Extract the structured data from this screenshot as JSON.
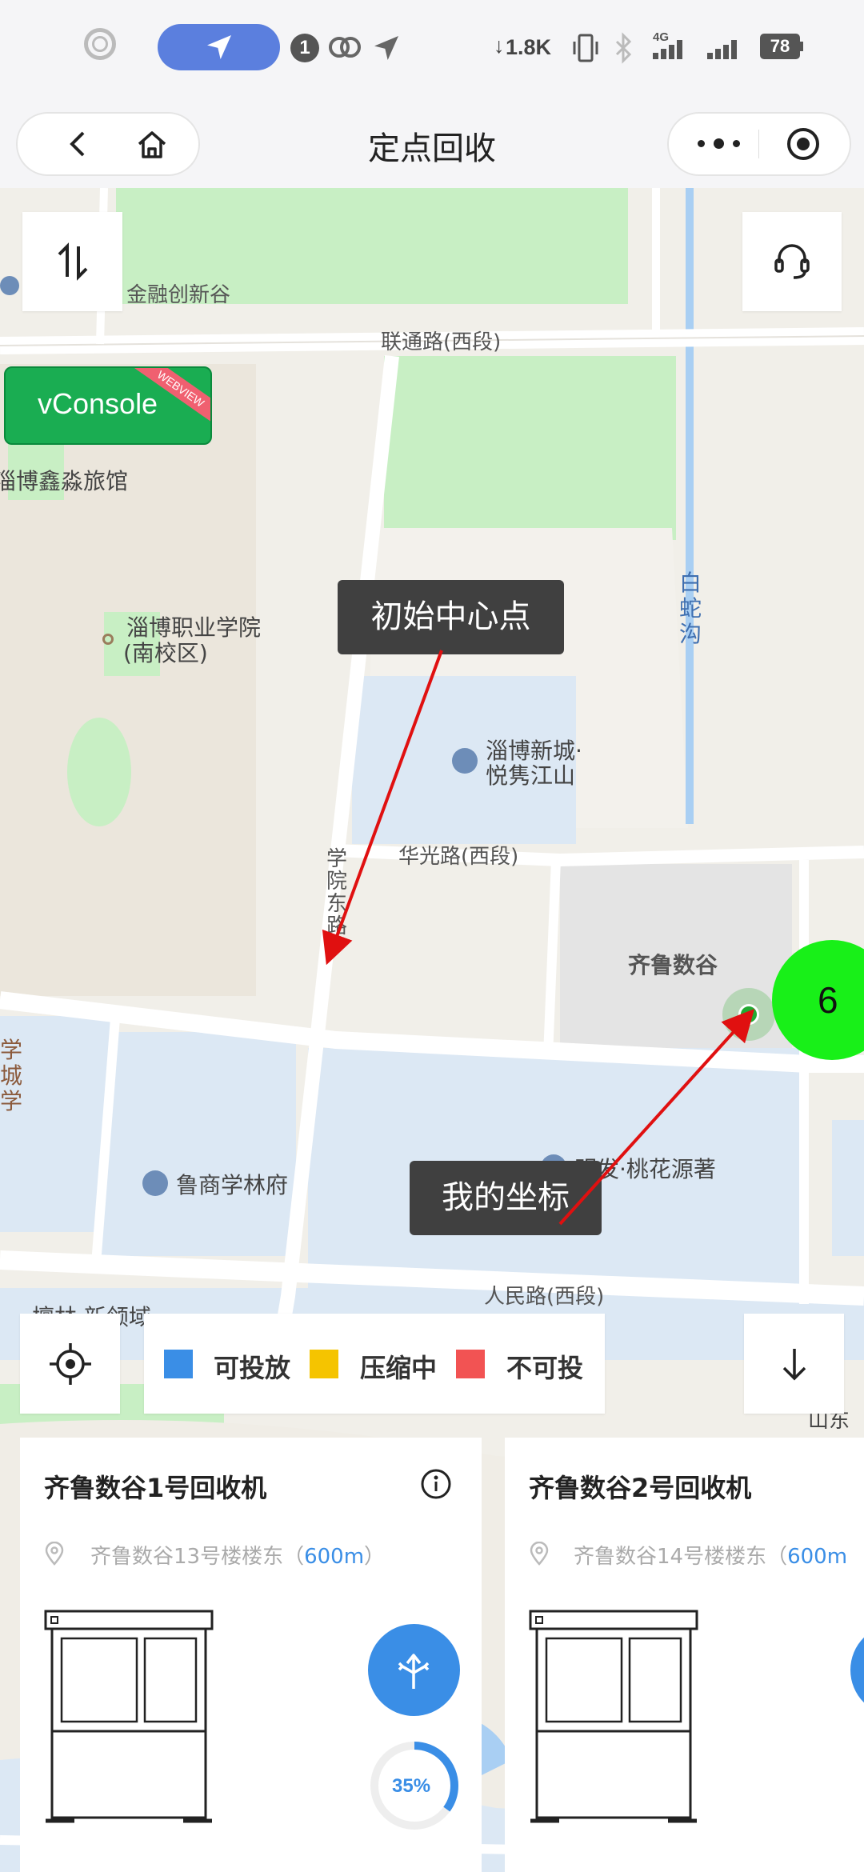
{
  "status_bar": {
    "notification_count": "1",
    "net_speed": "1.8K",
    "network_type": "4G",
    "battery": "78"
  },
  "nav": {
    "title": "定点回收"
  },
  "map": {
    "labels": {
      "financial_valley": "金融创新谷",
      "liantong_road": "联通路(西段)",
      "hotel": "淄博鑫淼旅馆",
      "college_line1": "淄博职业学院",
      "college_line2": "(南校区)",
      "baishe_creek": "白蛇沟",
      "xincheng_line1": "淄博新城·",
      "xincheng_line2": "悦隽江山",
      "huaguang_road": "华光路(西段)",
      "xueyuan_road": "学院东路",
      "qilu_valley": "齐鲁数谷",
      "xuecheng": "学城学",
      "lushang": "鲁商学林府",
      "mingfa": "明发·桃花源著",
      "renmin_road": "人民路(西段)",
      "linlin": "檀林·新领域",
      "shandong_partial": "山东"
    },
    "cluster_count": "6"
  },
  "vconsole": {
    "label": "vConsole",
    "ribbon": "WEBVIEW"
  },
  "annotations": {
    "initial_center": "初始中心点",
    "my_coordinate": "我的坐标"
  },
  "legend": {
    "items": [
      {
        "label": "可投放",
        "color": "#3a8ee6"
      },
      {
        "label": "压缩中",
        "color": "#f5c400"
      },
      {
        "label": "不可投",
        "color": "#f25353"
      }
    ]
  },
  "cards": [
    {
      "title": "齐鲁数谷1号回收机",
      "address": "齐鲁数谷13号楼楼东（",
      "distance": "600m",
      "address_end": "）",
      "progress": "35%"
    },
    {
      "title": "齐鲁数谷2号回收机",
      "address": "齐鲁数谷14号楼楼东（",
      "distance": "600m",
      "address_end": ""
    }
  ],
  "icons": {
    "back": "chevron-left-icon",
    "home": "home-icon",
    "more": "more-icon",
    "close": "target-icon",
    "swap": "swap-icon",
    "support": "headset-icon",
    "locate": "crosshair-icon",
    "collapse": "arrow-down-icon",
    "info": "info-icon",
    "pin": "location-pin-icon",
    "navigate": "directions-icon"
  }
}
